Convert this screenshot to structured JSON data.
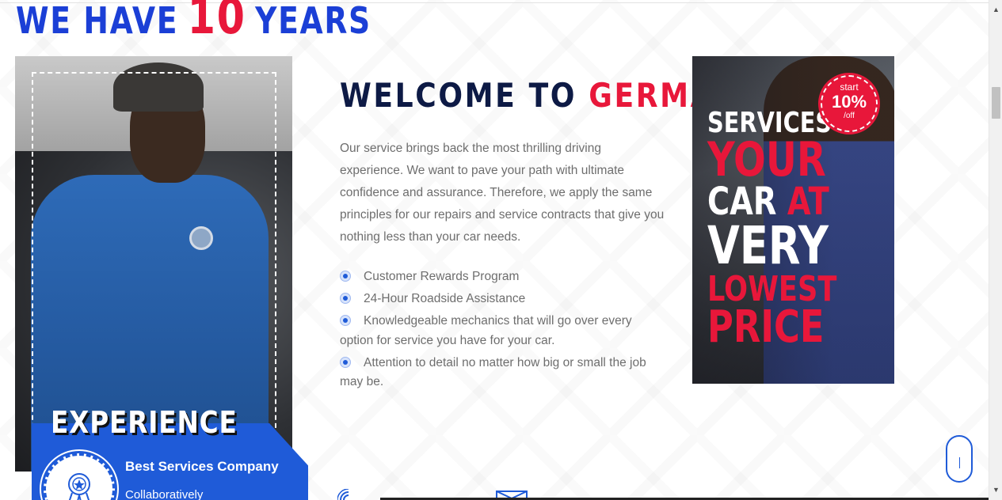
{
  "hero": {
    "headline_start": "WE HAVE",
    "headline_number": "10",
    "headline_end": "YEARS"
  },
  "experience_card": {
    "title": "EXPERIENCE",
    "company": "Best Services Company",
    "subtitle": "Collaboratively",
    "icon": "award-badge-icon"
  },
  "welcome": {
    "title_prefix": "WELCOME TO",
    "title_accent": "GERMAN",
    "intro": "Our service brings back the most thrilling driving experience. We want to pave your path with ultimate confidence and assurance. Therefore, we apply the same principles for our repairs and service contracts that give you nothing less than your car needs.",
    "features": [
      "Customer Rewards Program",
      "24-Hour Roadside Assistance",
      "Knowledgeable mechanics that will go over every option for service you have for your car.",
      "Attention to detail no matter how big or small the job may be."
    ]
  },
  "promo": {
    "line1": "SERVICES",
    "line2": "YOUR",
    "line3a": "CAR",
    "line3b": "AT",
    "line4": "VERY",
    "line5": "LOWEST",
    "line6": "PRICE",
    "badge_start": "start",
    "badge_percent": "10%",
    "badge_off": "/off"
  },
  "colors": {
    "brand_blue": "#1f5bd8",
    "accent_red": "#e8173a",
    "navy": "#0d1a45"
  }
}
